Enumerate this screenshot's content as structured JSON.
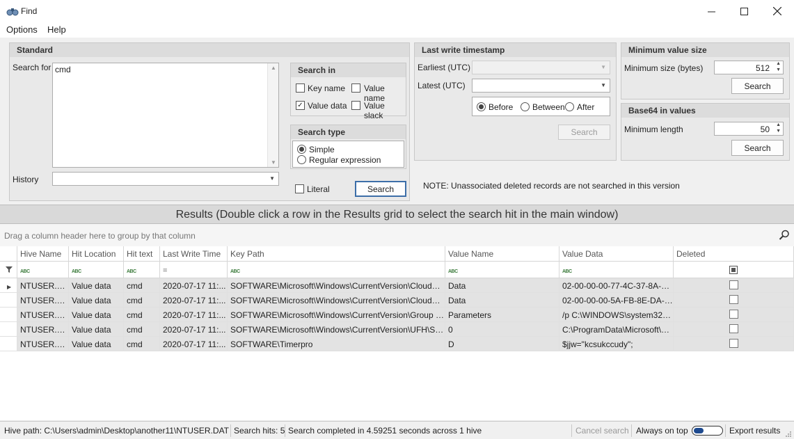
{
  "window": {
    "title": "Find"
  },
  "menu": [
    "Options",
    "Help"
  ],
  "standard": {
    "title": "Standard",
    "search_for_label": "Search for",
    "search_for_value": "cmd",
    "history_label": "History",
    "history_value": "",
    "search_in": {
      "title": "Search in",
      "key_name": "Key name",
      "key_name_checked": false,
      "value_name": "Value name",
      "value_name_checked": false,
      "value_data": "Value data",
      "value_data_checked": true,
      "value_slack": "Value slack",
      "value_slack_checked": false
    },
    "search_type": {
      "title": "Search type",
      "simple": "Simple",
      "regex": "Regular expression",
      "selected": "Simple"
    },
    "literal_label": "Literal",
    "literal_checked": false,
    "search_button": "Search"
  },
  "last_write": {
    "title": "Last write timestamp",
    "earliest_label": "Earliest (UTC)",
    "latest_label": "Latest (UTC)",
    "before": "Before",
    "between": "Between",
    "after": "After",
    "selected": "Before",
    "search_button": "Search"
  },
  "note": "NOTE: Unassociated deleted records are not searched in this version",
  "min_value_size": {
    "title": "Minimum value size",
    "label": "Minimum size (bytes)",
    "value": "512",
    "search_button": "Search"
  },
  "base64": {
    "title": "Base64 in values",
    "label": "Minimum length",
    "value": "50",
    "search_button": "Search"
  },
  "results": {
    "title": "Results (Double click a row in the Results grid to select the search hit in the main window)",
    "group_hint": "Drag a column header here to group by that column",
    "columns": [
      "Hive Name",
      "Hit Location",
      "Hit text",
      "Last Write Time",
      "Key Path",
      "Value Name",
      "Value Data",
      "Deleted"
    ],
    "rows": [
      {
        "hive": "NTUSER.DAT",
        "loc": "Value data",
        "hit": "cmd",
        "time": "2020-07-17 11:...",
        "path": "SOFTWARE\\Microsoft\\Windows\\CurrentVersion\\CloudStore\\...",
        "vname": "Data",
        "vdata": "02-00-00-00-77-4C-37-8A-2B-...",
        "deleted": false
      },
      {
        "hive": "NTUSER.DAT",
        "loc": "Value data",
        "hit": "cmd",
        "time": "2020-07-17 11:...",
        "path": "SOFTWARE\\Microsoft\\Windows\\CurrentVersion\\CloudStore\\...",
        "vname": "Data",
        "vdata": "02-00-00-00-5A-FB-8E-DA-2A...",
        "deleted": false
      },
      {
        "hive": "NTUSER.DAT",
        "loc": "Value data",
        "hit": "cmd",
        "time": "2020-07-17 11:...",
        "path": "SOFTWARE\\Microsoft\\Windows\\CurrentVersion\\Group Policy\\...",
        "vname": "Parameters",
        "vdata": "/p C:\\WINDOWS\\system32 /s ...",
        "deleted": false
      },
      {
        "hive": "NTUSER.DAT",
        "loc": "Value data",
        "hit": "cmd",
        "time": "2020-07-17 11:...",
        "path": "SOFTWARE\\Microsoft\\Windows\\CurrentVersion\\UFH\\SHC",
        "vname": "0",
        "vdata": "C:\\ProgramData\\Microsoft\\Wi...",
        "deleted": false
      },
      {
        "hive": "NTUSER.DAT",
        "loc": "Value data",
        "hit": "cmd",
        "time": "2020-07-17 11:...",
        "path": "SOFTWARE\\Timerpro",
        "vname": "D",
        "vdata": "$jjw=\"kcsukccudy\";",
        "deleted": false
      }
    ]
  },
  "status": {
    "hive_path": "Hive path: C:\\Users\\admin\\Desktop\\another11\\NTUSER.DAT",
    "hits": "Search hits: 5",
    "completed": "Search completed in 4.59251 seconds across 1 hive",
    "cancel": "Cancel search",
    "always_on_top": "Always on top",
    "export": "Export results"
  }
}
